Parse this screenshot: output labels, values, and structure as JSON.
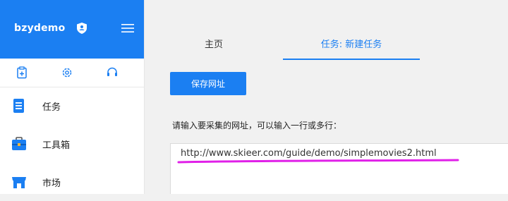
{
  "app": {
    "brand": "bzydemo",
    "brand_color": "#1b7ff2",
    "icons": {
      "badge": "shield-user-icon",
      "menu": "hamburger-menu-icon"
    }
  },
  "toolbar": {
    "icons": [
      "clipboard-add-icon",
      "gear-icon",
      "headset-icon"
    ]
  },
  "sidebar": {
    "items": [
      {
        "label": "任务",
        "icon": "task-list-icon"
      },
      {
        "label": "工具箱",
        "icon": "toolbox-icon"
      },
      {
        "label": "市场",
        "icon": "market-store-icon"
      }
    ]
  },
  "tabs": [
    {
      "label": "主页",
      "active": false
    },
    {
      "label": "任务: 新建任务",
      "active": true
    }
  ],
  "main": {
    "save_label": "保存网址",
    "hint": "请输入要采集的网址，可以输入一行或多行：",
    "url_value": "http://www.skieer.com/guide/demo/simplemovies2.html",
    "annotation_color": "#e020e8"
  }
}
